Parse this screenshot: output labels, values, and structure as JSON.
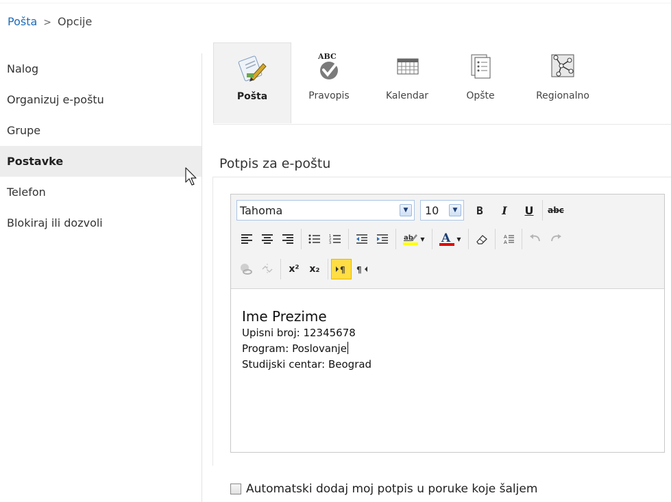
{
  "breadcrumb": {
    "root": "Pošta",
    "separator": ">",
    "current": "Opcije"
  },
  "nav": {
    "items": [
      {
        "label": "Nalog"
      },
      {
        "label": "Organizuj e-poštu"
      },
      {
        "label": "Grupe"
      },
      {
        "label": "Postavke",
        "selected": true
      },
      {
        "label": "Telefon"
      },
      {
        "label": "Blokiraj ili dozvoli"
      }
    ]
  },
  "tabs": [
    {
      "label": "Pošta",
      "icon": "mail-edit-icon",
      "active": true
    },
    {
      "label": "Pravopis",
      "icon": "spellcheck-icon"
    },
    {
      "label": "Kalendar",
      "icon": "calendar-icon"
    },
    {
      "label": "Opšte",
      "icon": "general-settings-icon"
    },
    {
      "label": "Regionalno",
      "icon": "regional-map-icon"
    }
  ],
  "section": {
    "title": "Potpis za e-poštu"
  },
  "editor": {
    "font_family": "Tahoma",
    "font_size": "10",
    "bold_label": "B",
    "italic_label": "I",
    "underline_label": "U",
    "strike_label": "abc",
    "superscript_label": "x²",
    "subscript_label": "x₂",
    "content": {
      "name": "Ime Prezime",
      "line2": "Upisni broj: 12345678",
      "line3": "Program: Poslovanje",
      "line4": "Studijski centar: Beograd"
    }
  },
  "auto_signature": {
    "label": "Automatski dodaj moj potpis u poruke koje šaljem",
    "checked": false
  },
  "colors": {
    "link": "#1e6bb8",
    "selected_nav_bg": "#ededed",
    "active_button": "#ffdd44",
    "font_color_bar": "#e00000",
    "highlight_bar": "#ffff00"
  }
}
